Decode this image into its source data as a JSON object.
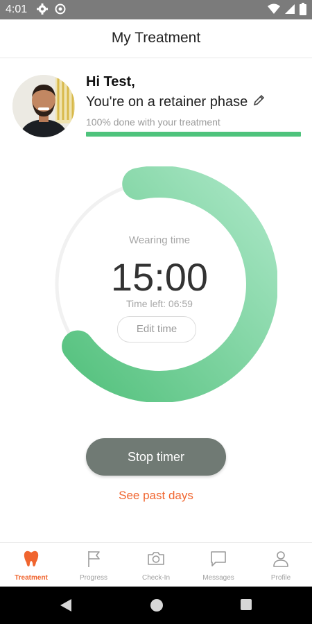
{
  "status_bar": {
    "time": "4:01",
    "icons": [
      "settings-icon",
      "data-saver-icon",
      "wifi-icon",
      "signal-icon",
      "battery-icon"
    ]
  },
  "app_bar": {
    "title": "My Treatment"
  },
  "profile": {
    "greeting": "Hi Test,",
    "phase_text": "You're on a retainer phase",
    "progress_text": "100% done with your treatment",
    "progress_fraction": 1.0
  },
  "timer": {
    "label": "Wearing time",
    "value": "15:00",
    "time_left": "Time left: 06:59",
    "edit_label": "Edit time",
    "ring_fraction": 0.68
  },
  "actions": {
    "stop_label": "Stop timer",
    "past_days_label": "See past days"
  },
  "tabs": [
    {
      "label": "Treatment",
      "icon": "tooth-icon",
      "active": true
    },
    {
      "label": "Progress",
      "icon": "flag-icon",
      "active": false
    },
    {
      "label": "Check-In",
      "icon": "camera-icon",
      "active": false
    },
    {
      "label": "Messages",
      "icon": "chat-icon",
      "active": false
    },
    {
      "label": "Profile",
      "icon": "person-icon",
      "active": false
    }
  ],
  "colors": {
    "accent": "#f0652f",
    "progress_green": "#4ec37c",
    "ring_start": "#a9e6c5",
    "ring_end": "#56c27f",
    "button_gray": "#707a74"
  }
}
